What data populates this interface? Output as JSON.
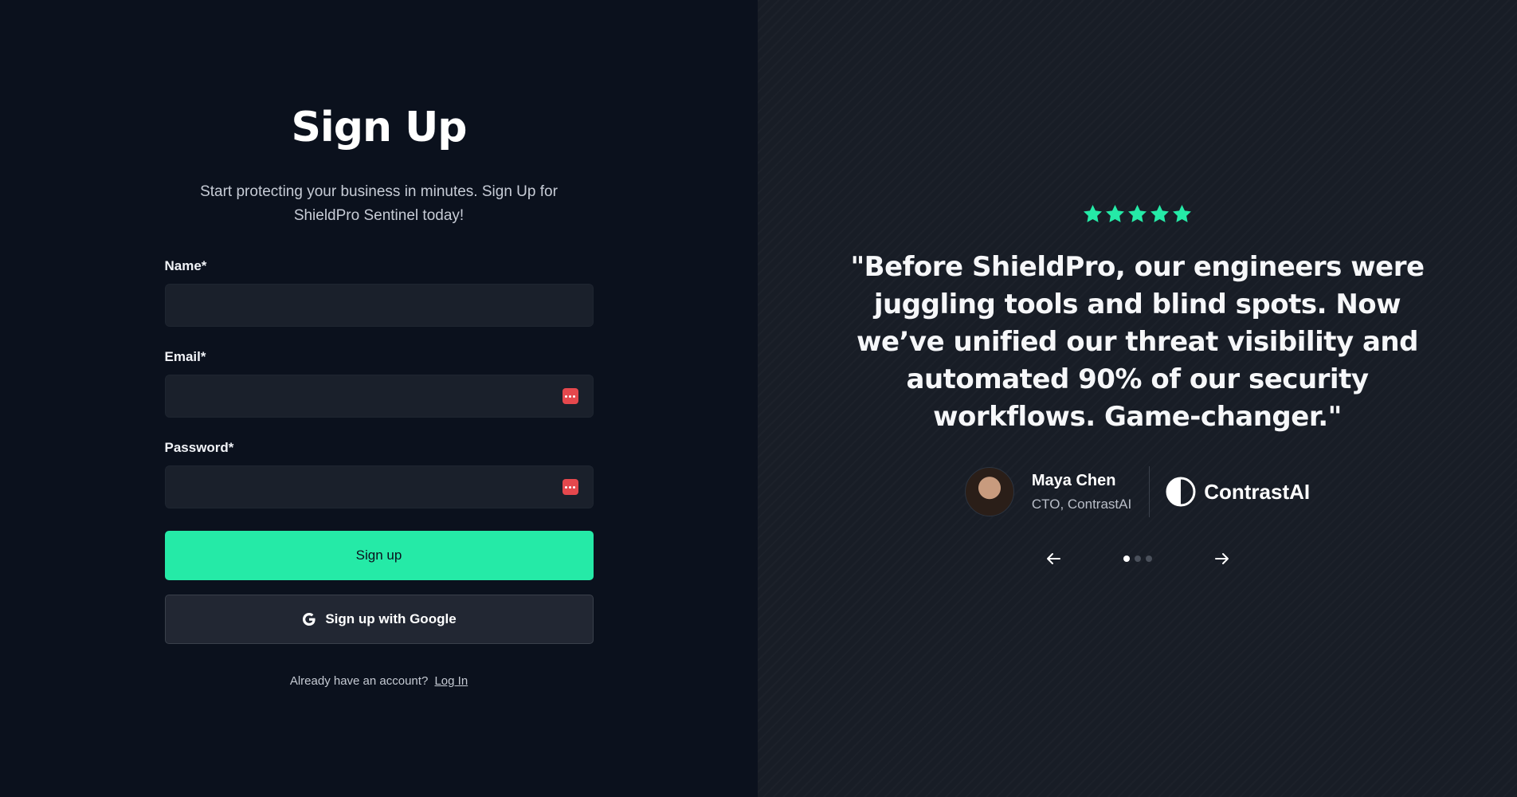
{
  "signup": {
    "title": "Sign Up",
    "subtitle": "Start protecting your business in minutes. Sign Up for ShieldPro Sentinel today!",
    "name_label": "Name*",
    "email_label": "Email*",
    "password_label": "Password*",
    "name_value": "",
    "email_value": "",
    "password_value": "",
    "submit_label": "Sign up",
    "google_label": "Sign up with Google",
    "already_text": "Already have an account?",
    "login_link": "Log In"
  },
  "testimonial": {
    "rating": 5,
    "quote": "\"Before ShieldPro, our engineers were juggling tools and blind spots. Now we’ve unified our threat visibility and automated 90% of our security workflows. Game-changer.\"",
    "author_name": "Maya Chen",
    "author_role": "CTO, ContrastAI",
    "company_name": "ContrastAI",
    "slides": 3,
    "active_slide": 1
  },
  "colors": {
    "accent": "#25eaa7",
    "left_bg": "#0b111d",
    "right_bg": "#181d26",
    "password_manager_icon": "#e5484d"
  },
  "icons": {
    "google": "google-g-icon",
    "password_manager": "password-manager-icon",
    "star": "star-icon",
    "prev": "arrow-left-icon",
    "next": "arrow-right-icon",
    "company_logo": "half-circle-logo-icon"
  }
}
